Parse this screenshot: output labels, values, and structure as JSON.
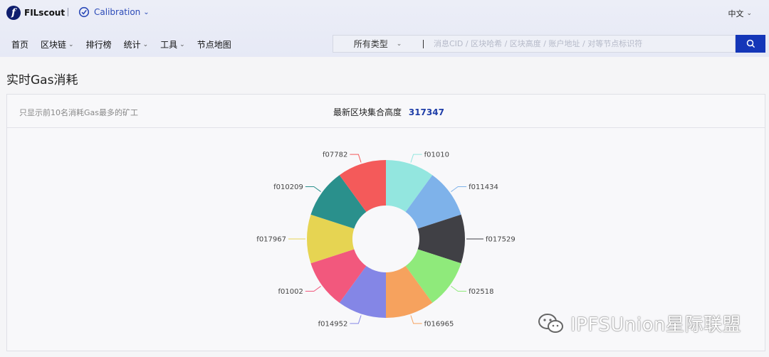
{
  "header": {
    "brand": "FILscout",
    "brand_logo_letter": "f",
    "network": "Calibration",
    "language": "中文"
  },
  "nav": {
    "items": [
      {
        "label": "首页",
        "has_dropdown": false
      },
      {
        "label": "区块链",
        "has_dropdown": true
      },
      {
        "label": "排行榜",
        "has_dropdown": false
      },
      {
        "label": "统计",
        "has_dropdown": true
      },
      {
        "label": "工具",
        "has_dropdown": true
      },
      {
        "label": "节点地图",
        "has_dropdown": false
      }
    ]
  },
  "search": {
    "type_label": "所有类型",
    "placeholder": "消息CID / 区块哈希 / 区块高度 / 账户地址 / 对等节点标识符",
    "value": ""
  },
  "page": {
    "title": "实时Gas消耗"
  },
  "card": {
    "hint": "只显示前10名消耗Gas最多的矿工",
    "height_label": "最新区块集合高度",
    "height_value": "317347"
  },
  "chart_data": {
    "type": "pie",
    "donut": true,
    "categories": [
      "f01010",
      "f011434",
      "f017529",
      "f02518",
      "f016965",
      "f014952",
      "f01002",
      "f017967",
      "f010209",
      "f07782"
    ],
    "values": [
      10,
      10,
      10,
      10,
      10,
      10,
      10,
      10,
      10,
      10
    ],
    "colors": [
      "#93e6df",
      "#7eb2ea",
      "#404045",
      "#8fea7b",
      "#f6a25e",
      "#8486e6",
      "#f2587d",
      "#e6d452",
      "#2a908c",
      "#f45a5a"
    ],
    "legend": "none"
  },
  "watermark": {
    "text": "IPFSUnion星际联盟",
    "icon": "wechat-icon"
  },
  "colors": {
    "accent": "#1436b8",
    "height_value": "#1f3ea8"
  }
}
